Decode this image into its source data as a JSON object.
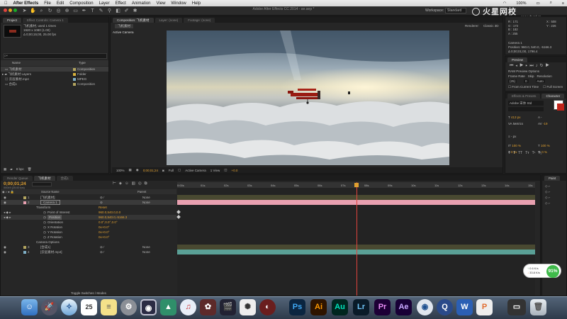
{
  "menubar": {
    "app": "After Effects",
    "items": [
      "File",
      "Edit",
      "Composition",
      "Layer",
      "Effect",
      "Animation",
      "View",
      "Window",
      "Help"
    ],
    "battery": "100%"
  },
  "window_title": "Adobe After Effects CC 2014 - ae.aep *",
  "workspace": {
    "label": "Workspace:",
    "value": "Standard"
  },
  "watermark": {
    "site": "www.vhxsd.cn"
  },
  "project": {
    "tab": "Project",
    "tab2": "Effect Controls: Camera 1",
    "item_name": "飞机素材",
    "item_used": "used 1 times",
    "item_size": "Δ 0;00;15;00, 25.00 fps",
    "col_name": "Name",
    "col_type": "Type",
    "items": [
      {
        "name": "飞机素材",
        "type": "Composition"
      },
      {
        "name": "飞机素材 Layers",
        "type": "Folder"
      },
      {
        "name": "云层素材.mp4",
        "type": "MPEG"
      },
      {
        "name": "合成1",
        "type": "Composition"
      }
    ],
    "bpc": "8 bpc"
  },
  "viewer": {
    "tabs": [
      "Composition: 飞机素材",
      "Layer: (none)",
      "Footage: (none)"
    ],
    "breadcrumb": "飞机素材",
    "active_camera": "Active Camera",
    "renderer_label": "Renderer:",
    "renderer": "Classic 3D",
    "zoom": "100%",
    "time": "0;00;01;24",
    "resolution": "Full",
    "view": "Active Camera",
    "views": "1 View",
    "exposure": "+0.0"
  },
  "info": {
    "r": "R : 171",
    "g": "G : 172",
    "b": "B : 182",
    "a": "A : 255",
    "x": "X : 508",
    "y": "Y : 226",
    "camera": "Camera 1",
    "position": "Position: 960.0, 540.0, -5166.3",
    "duration": "Δ 0;00;01;00, 1796.4"
  },
  "preview": {
    "tab": "Preview",
    "ram": "RAM Preview Options",
    "frame_rate": "Frame Rate",
    "skip": "Skip",
    "resolution_label": "Resolution",
    "fps": "(25)",
    "skip_val": "0",
    "res_val": "Auto",
    "from_current": "From Current Time",
    "full_screen": "Full Screen"
  },
  "character": {
    "tab1": "Effects & Presets",
    "tab2": "Character",
    "font": "Adobe 宋体 Std",
    "size": "413 px",
    "metrics": "Metrics",
    "tracking": "-19",
    "leading": "- px",
    "vscale": "100 %",
    "hscale": "100 %",
    "baseline": "0 px",
    "tsume": "0 %"
  },
  "timeline": {
    "tabs": [
      "Render Queue",
      "飞机素材",
      "合成1"
    ],
    "time": "0;00;01;24",
    "fps": "00049 (25.00 fps)",
    "col_source": "Source Name",
    "col_parent": "Parent",
    "ticks": [
      "0:00s",
      "01s",
      "02s",
      "03s",
      "04s",
      "05s",
      "06s",
      "07s",
      "08s",
      "09s",
      "10s",
      "11s",
      "12s",
      "13s",
      "14s",
      "15s"
    ],
    "layers": [
      {
        "num": "1",
        "name": "[飞机素材]",
        "parent": "None"
      },
      {
        "num": "2",
        "name": "Camera 1",
        "parent": "None"
      },
      {
        "num": "3",
        "name": "[合成1]",
        "parent": "None"
      },
      {
        "num": "4",
        "name": "[云层素材.mp4]",
        "parent": "None"
      }
    ],
    "transform": "Transform",
    "reset": "Reset",
    "props": [
      {
        "name": "Point of Interest",
        "value": "960.0,540.0,0.0"
      },
      {
        "name": "Position",
        "value": "960.0,540.0,-5166.3"
      },
      {
        "name": "Orientation",
        "value": "0.0°,0.0°,0.0°"
      },
      {
        "name": "X Rotation",
        "value": "0x+0.0°"
      },
      {
        "name": "Y Rotation",
        "value": "0x+0.0°"
      },
      {
        "name": "Z Rotation",
        "value": "0x+0.0°"
      }
    ],
    "camera_options": "Camera Options",
    "toggle": "Toggle Switches / Modes",
    "playhead_fraction": 0.5
  },
  "paint": {
    "tab": "Paint"
  },
  "netspeed": {
    "up": "0.6 K/s",
    "down": "33.8 K/s",
    "percent": "91%"
  },
  "dock": {
    "apps": [
      "Finder",
      "Launchpad",
      "Safari",
      "Calendar",
      "Notes",
      "System Preferences",
      "Photo Booth",
      "Dreamweaver",
      "iTunes",
      "DaVinci",
      "Final Cut Pro",
      "Photos",
      "Motion",
      "Photoshop",
      "Illustrator",
      "Audition",
      "Lightroom",
      "Premiere Pro",
      "After Effects",
      "Cinema 4D",
      "QuickTime",
      "Word",
      "Pages",
      "Premiere Pro Folder",
      "Trash"
    ],
    "calendar_day": "25"
  }
}
